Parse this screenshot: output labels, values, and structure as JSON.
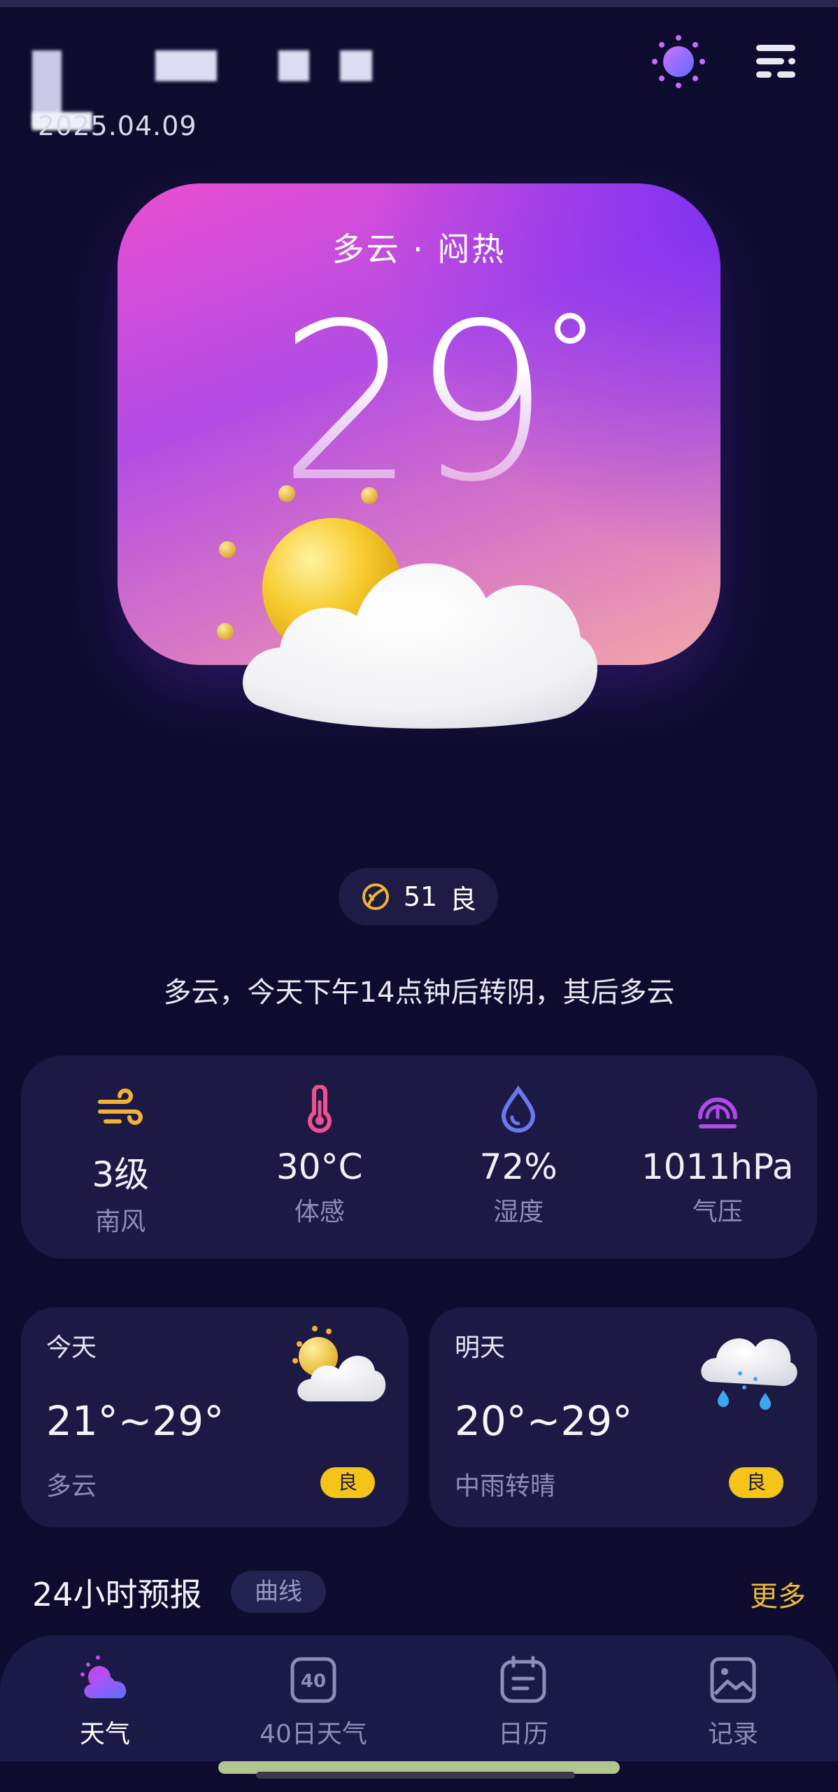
{
  "header": {
    "date": "2025.04.09",
    "theme_icon": "sun-theme-icon",
    "menu_icon": "menu-icon"
  },
  "hero": {
    "condition": "多云 · 闷热",
    "temperature": "29"
  },
  "aqi": {
    "value": "51",
    "level": "良",
    "icon": "leaf-icon"
  },
  "summary": "多云，今天下午14点钟后转阴，其后多云",
  "metrics": [
    {
      "value": "3级",
      "label": "南风",
      "icon": "wind-icon",
      "color": "#f2b233"
    },
    {
      "value": "30°C",
      "label": "体感",
      "icon": "thermometer-icon",
      "color": "#f0508c"
    },
    {
      "value": "72%",
      "label": "湿度",
      "icon": "water-drop-icon",
      "color": "#6b78f0"
    },
    {
      "value": "1011hPa",
      "label": "气压",
      "icon": "gauge-icon",
      "color": "#b04ae8"
    }
  ],
  "days": [
    {
      "title": "今天",
      "range": "21°~29°",
      "condition": "多云",
      "aqi_level": "良",
      "icon": "partly-cloudy-icon"
    },
    {
      "title": "明天",
      "range": "20°~29°",
      "condition": "中雨转晴",
      "aqi_level": "良",
      "icon": "rain-cloud-icon"
    }
  ],
  "forecast24": {
    "title": "24小时预报",
    "curve_label": "曲线",
    "more_label": "更多"
  },
  "nav": [
    {
      "label": "天气",
      "icon": "weather-icon",
      "active": true
    },
    {
      "label": "40日天气",
      "icon": "forty-day-icon",
      "active": false
    },
    {
      "label": "日历",
      "icon": "calendar-icon",
      "active": false
    },
    {
      "label": "记录",
      "icon": "gallery-icon",
      "active": false
    }
  ],
  "colors": {
    "background": "#0e0c2e",
    "card": "#1c1a45",
    "accent_yellow": "#f5c418",
    "more_link": "#f0b83a"
  }
}
